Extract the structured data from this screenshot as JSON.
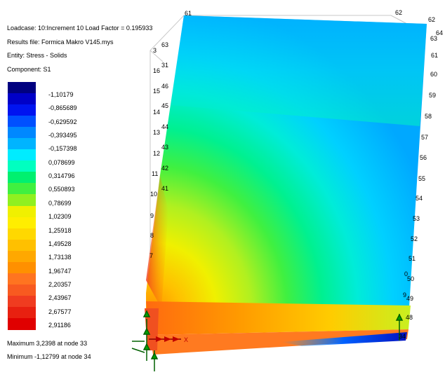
{
  "header": {
    "loadcase": "Loadcase: 10:Increment 10 Load Factor = 0.195933",
    "results_file": "Results file: Formica Makro V145.mys",
    "entity": "Entity: Stress - Solids",
    "component": "Component: S1"
  },
  "legend": {
    "colors": [
      "#000080",
      "#0000c8",
      "#0014f0",
      "#0050ff",
      "#0088ff",
      "#00b4ff",
      "#00ecff",
      "#00ffc0",
      "#00f070",
      "#40f040",
      "#90f020",
      "#f0f000",
      "#ffee00",
      "#ffd800",
      "#ffc000",
      "#ffa800",
      "#ff9000",
      "#ff7420",
      "#f85a20",
      "#f03c20",
      "#e82010",
      "#e00000"
    ],
    "labels": [
      "-1,10179",
      "-0,865689",
      "-0,629592",
      "-0,393495",
      "-0,157398",
      "0,078699",
      "0,314796",
      "0,550893",
      "0,78699",
      "1,02309",
      "1,25918",
      "1,49528",
      "1,73138",
      "1,96747",
      "2,20357",
      "2,43967",
      "2,67577",
      "2,91186"
    ]
  },
  "extrema": {
    "maximum": "Maximum 3,2398 at node 33",
    "minimum": "Minimum -1,12799 at node 34"
  },
  "nodes": {
    "top": [
      "61",
      "62",
      "62",
      "64"
    ],
    "left": [
      "63",
      "3",
      "31",
      "16",
      "46",
      "15",
      "45",
      "14",
      "44",
      "13",
      "43",
      "12",
      "42",
      "11",
      "41",
      "10",
      "9",
      "8",
      "7"
    ],
    "right": [
      "63",
      "61",
      "60",
      "59",
      "58",
      "57",
      "56",
      "55",
      "54",
      "53",
      "52",
      "51",
      "0",
      "50",
      "9",
      "49",
      "48",
      "34"
    ]
  },
  "axis": {
    "x_label": "X"
  }
}
